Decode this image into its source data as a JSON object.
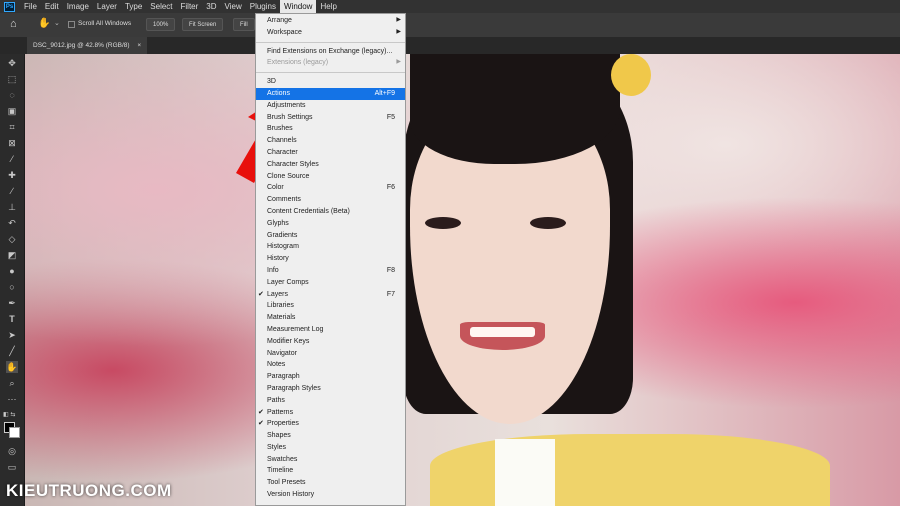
{
  "menubar": {
    "logo": "Ps",
    "items": [
      "File",
      "Edit",
      "Image",
      "Layer",
      "Type",
      "Select",
      "Filter",
      "3D",
      "View",
      "Plugins",
      "Window",
      "Help"
    ],
    "active": "Window"
  },
  "options_bar": {
    "scroll_all_windows": "Scroll All Windows",
    "zoom_100": "100%",
    "fit_screen": "Fit Screen",
    "fill_screen": "Fill S"
  },
  "document_tab": {
    "title": "DSC_9012.jpg @ 42.8% (RGB/8)",
    "close": "×"
  },
  "window_menu": {
    "items": [
      {
        "label": "Arrange",
        "submenu": true
      },
      {
        "label": "Workspace",
        "submenu": true
      },
      {
        "sep": true
      },
      {
        "label": "Find Extensions on Exchange (legacy)...",
        "submenu": false
      },
      {
        "label": "Extensions (legacy)",
        "submenu": true,
        "disabled": true
      },
      {
        "sep": true
      },
      {
        "label": "3D"
      },
      {
        "label": "Actions",
        "shortcut": "Alt+F9",
        "highlight": true
      },
      {
        "label": "Adjustments"
      },
      {
        "label": "Brush Settings",
        "shortcut": "F5"
      },
      {
        "label": "Brushes"
      },
      {
        "label": "Channels"
      },
      {
        "label": "Character"
      },
      {
        "label": "Character Styles"
      },
      {
        "label": "Clone Source"
      },
      {
        "label": "Color",
        "shortcut": "F6"
      },
      {
        "label": "Comments"
      },
      {
        "label": "Content Credentials (Beta)"
      },
      {
        "label": "Glyphs"
      },
      {
        "label": "Gradients"
      },
      {
        "label": "Histogram"
      },
      {
        "label": "History"
      },
      {
        "label": "Info",
        "shortcut": "F8"
      },
      {
        "label": "Layer Comps"
      },
      {
        "label": "Layers",
        "shortcut": "F7",
        "checked": true
      },
      {
        "label": "Libraries"
      },
      {
        "label": "Materials"
      },
      {
        "label": "Measurement Log"
      },
      {
        "label": "Modifier Keys"
      },
      {
        "label": "Navigator"
      },
      {
        "label": "Notes"
      },
      {
        "label": "Paragraph"
      },
      {
        "label": "Paragraph Styles"
      },
      {
        "label": "Paths"
      },
      {
        "label": "Patterns",
        "checked": true
      },
      {
        "label": "Properties",
        "checked": true
      },
      {
        "label": "Shapes"
      },
      {
        "label": "Styles"
      },
      {
        "label": "Swatches"
      },
      {
        "label": "Timeline"
      },
      {
        "label": "Tool Presets"
      },
      {
        "label": "Version History"
      }
    ]
  },
  "tools": [
    "move-tool",
    "marquee-tool",
    "lasso-tool",
    "object-select-tool",
    "crop-tool",
    "frame-tool",
    "eyedropper-tool",
    "healing-tool",
    "brush-tool",
    "stamp-tool",
    "history-brush-tool",
    "eraser-tool",
    "gradient-tool",
    "blur-tool",
    "dodge-tool",
    "pen-tool",
    "type-tool",
    "path-select-tool",
    "shape-tool",
    "hand-tool",
    "zoom-tool",
    "more-tools"
  ],
  "watermark": "KIEUTRUONG.COM",
  "colors": {
    "highlight": "#1473e6",
    "arrow": "#e8100c",
    "menubar": "#323232"
  }
}
